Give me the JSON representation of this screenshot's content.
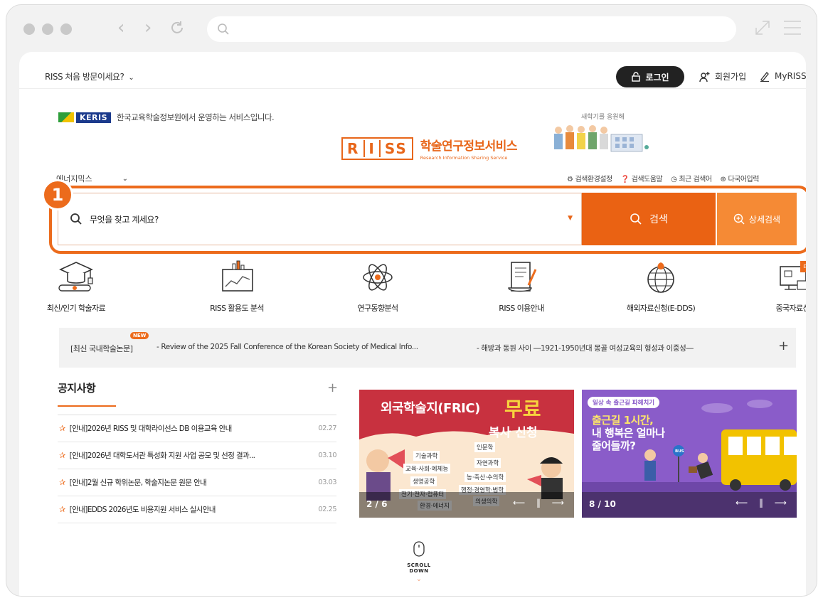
{
  "browser": {
    "window_controls": [
      "close",
      "minimize",
      "maximize"
    ],
    "nav_icons": [
      "back-icon",
      "forward-icon",
      "reload-icon"
    ],
    "url": ""
  },
  "topbar": {
    "first_visit": "RISS 처음 방문이세요?",
    "login": "로그인",
    "signup": "회원가입",
    "myriss": "MyRISS"
  },
  "brand": {
    "keris_label": "KERIS",
    "keris_text": "한국교육학술정보원에서 운영하는 서비스입니다.",
    "logo_letters": [
      "R",
      "I",
      "SS"
    ],
    "logo_title": "학술연구정보서비스",
    "logo_subtitle": "Research Information Sharing Service",
    "promo_caption": "새학기를 응원해"
  },
  "search": {
    "scope": "에너지믹스",
    "tools": [
      {
        "icon": "gear-icon",
        "label": "검색환경설정"
      },
      {
        "icon": "help-icon",
        "label": "검색도움말"
      },
      {
        "icon": "clock-icon",
        "label": "최근 검색어"
      },
      {
        "icon": "globe-icon",
        "label": "다국어입력"
      }
    ],
    "placeholder": "무엇을 찾고 계세요?",
    "search_label": "검색",
    "advanced_label": "상세검색",
    "step_badge": "1"
  },
  "quick_links": [
    {
      "label": "최신/인기 학술자료",
      "icon": "graduation-cap-icon"
    },
    {
      "label": "RISS 활용도 분석",
      "icon": "chart-icon"
    },
    {
      "label": "연구동향분석",
      "icon": "atom-icon"
    },
    {
      "label": "RISS 이용안내",
      "icon": "scroll-icon"
    },
    {
      "label": "해외자료신청(E-DDS)",
      "icon": "globe-location-icon"
    },
    {
      "label": "중국자료신청",
      "icon": "monitor-book-icon"
    }
  ],
  "ticker": {
    "tag": "[최신 국내학술논문]",
    "new_badge": "NEW",
    "item1": "- Review of the 2025 Fall Conference of the Korean Society of Medical Info...",
    "item2": "- 해방과 동원 사이 ―1921-1950년대 몽골 여성교육의 형성과 이중성―",
    "plus": "+"
  },
  "notice": {
    "title": "공지사항",
    "plus": "+",
    "items": [
      {
        "text": "[안내]2026년 RISS 및 대학라이선스 DB 이용교육 안내",
        "date": "02.27"
      },
      {
        "text": "[안내]2026년 대학도서관 특성화 지원 사업 공모 및 선정 결과...",
        "date": "03.10"
      },
      {
        "text": "[안내]2월 신규 학위논문, 학술지논문 원문 안내",
        "date": "03.03"
      },
      {
        "text": "[안내]EDDS 2026년도 비용지원 서비스 실시안내",
        "date": "02.25"
      }
    ]
  },
  "banners": [
    {
      "title1": "외국학술지(FRIC)",
      "title2": "무료",
      "title3": "복사 신청",
      "tags": [
        "기술과학",
        "인문학",
        "교육·사회·예체능",
        "자연과학",
        "생명공학",
        "농·축산·수의학",
        "전기·전자·컴퓨터",
        "행정·경영학·법학",
        "환경·에너지",
        "의생의학"
      ],
      "counter": "2 / 6",
      "colors": {
        "bg": "#c8313f",
        "accent": "#f7d33e"
      }
    },
    {
      "pill": "일상 속 출근길 파헤치기",
      "title1": "출근길 1시간,",
      "title2": "내 행복은 얼마나",
      "title3": "줄어들까?",
      "bus_sign": "BUS",
      "counter": "8 / 10",
      "colors": {
        "bg": "#8a5cc9",
        "accent": "#f2c200"
      }
    }
  ],
  "scroll_hint": "SCROLL DOWN",
  "colors": {
    "brand": "#ea6213",
    "brand_light": "#f58a35"
  }
}
